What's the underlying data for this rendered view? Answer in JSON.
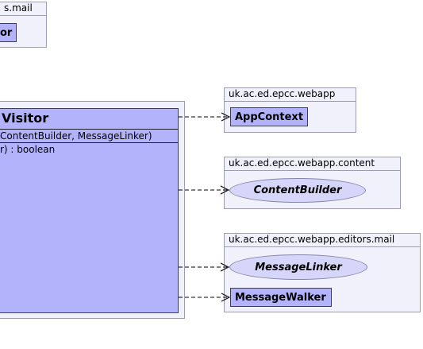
{
  "packages": {
    "mail_partial": {
      "label": "s.mail",
      "class_label": "or"
    },
    "webapp": {
      "label": "uk.ac.ed.epcc.webapp",
      "class_label": "AppContext"
    },
    "content": {
      "label": "uk.ac.ed.epcc.webapp.content",
      "interface_label": "ContentBuilder"
    },
    "editors_mail": {
      "label": "uk.ac.ed.epcc.webapp.editors.mail",
      "interface_label": "MessageLinker",
      "class_label": "MessageWalker"
    }
  },
  "main_class": {
    "title": "Visitor",
    "constructor_sig": " ContentBuilder, MessageLinker)",
    "method_sig": "r) : boolean"
  },
  "colors": {
    "package_fill": "#f1f1fc",
    "class_fill": "#b3b3fc",
    "interface_fill": "#d6d6fa",
    "border": "#3d3d5a"
  }
}
